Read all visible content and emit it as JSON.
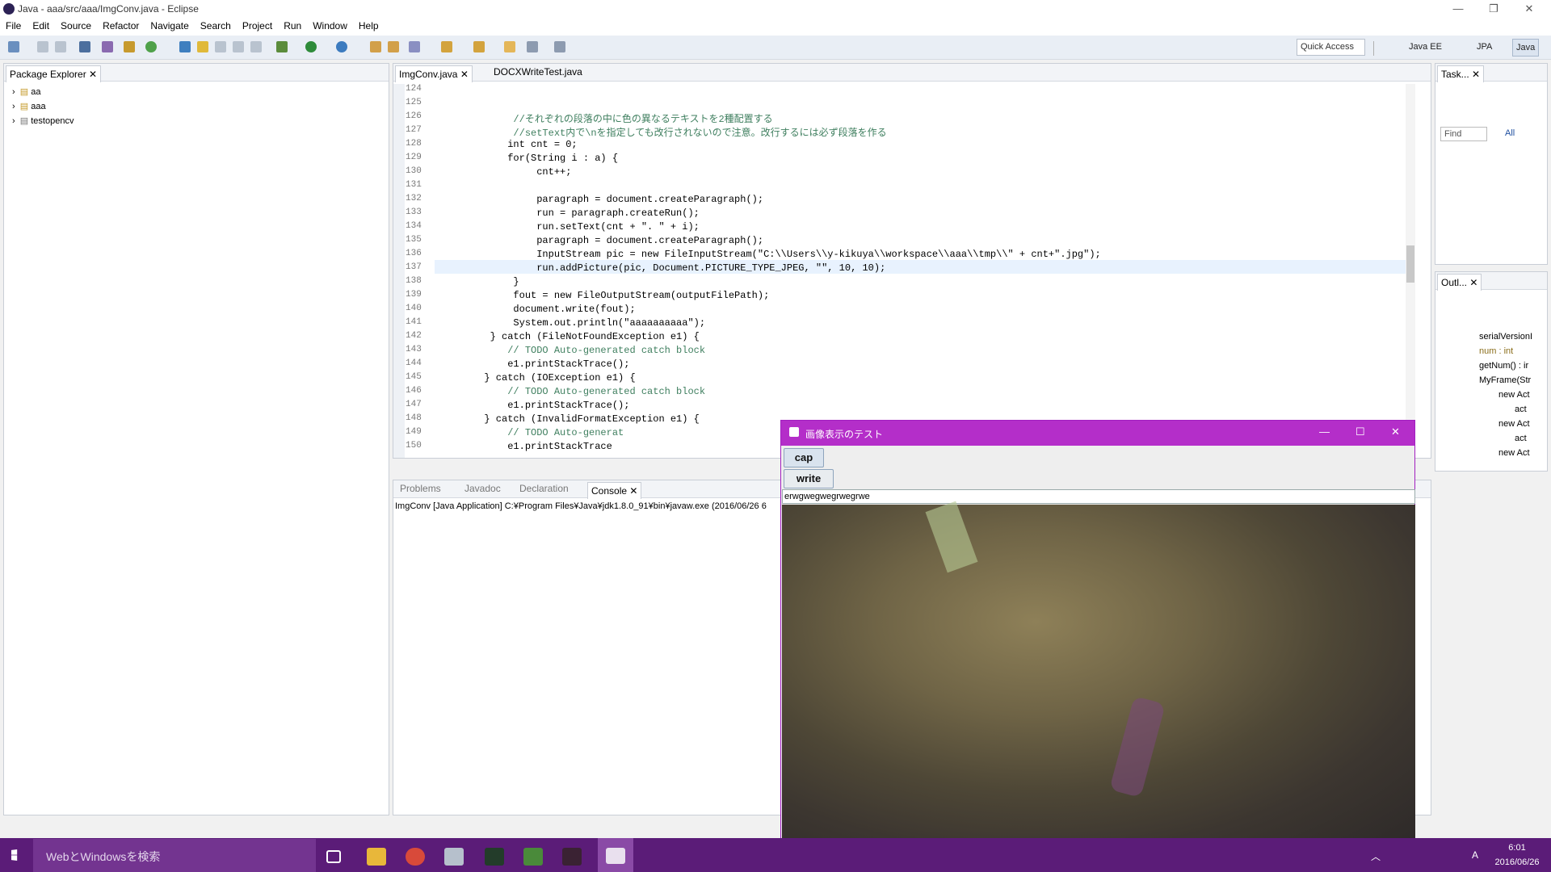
{
  "window": {
    "title": "Java - aaa/src/aaa/ImgConv.java - Eclipse",
    "min": "—",
    "max": "❐",
    "close": "✕"
  },
  "menu": [
    "File",
    "Edit",
    "Source",
    "Refactor",
    "Navigate",
    "Search",
    "Project",
    "Run",
    "Window",
    "Help"
  ],
  "toolbar": {
    "quick_access": "Quick Access"
  },
  "perspectives": [
    "Java EE",
    "JPA",
    "Java"
  ],
  "package_explorer": {
    "title": "Package Explorer",
    "items": [
      "aa",
      "aaa",
      "testopencv"
    ]
  },
  "editor": {
    "tabs": [
      "ImgConv.java",
      "DOCXWriteTest.java"
    ],
    "lines": [
      {
        "n": "124",
        "t": ""
      },
      {
        "n": "125",
        "t": ""
      },
      {
        "n": "126",
        "t": "            //それぞれの段落の中に色の異なるテキストを2種配置する",
        "c": "cm"
      },
      {
        "n": "127",
        "t": "            //setText内で\\nを指定しても改行されないので注意。改行するには必ず段落を作る",
        "c": "cm"
      },
      {
        "n": "128",
        "t": "           int cnt = 0;"
      },
      {
        "n": "129",
        "t": "           for(String i : a) {"
      },
      {
        "n": "130",
        "t": "                cnt++;"
      },
      {
        "n": "131",
        "t": ""
      },
      {
        "n": "132",
        "t": "                paragraph = document.createParagraph();"
      },
      {
        "n": "133",
        "t": "                run = paragraph.createRun();"
      },
      {
        "n": "134",
        "t": "                run.setText(cnt + \". \" + i);"
      },
      {
        "n": "135",
        "t": "                paragraph = document.createParagraph();"
      },
      {
        "n": "136",
        "t": "                InputStream pic = new FileInputStream(\"C:\\\\Users\\\\y-kikuya\\\\workspace\\\\aaa\\\\tmp\\\\\" + cnt+\".jpg\");"
      },
      {
        "n": "137",
        "t": "                run.addPicture(pic, Document.PICTURE_TYPE_JPEG, \"\", 10, 10);"
      },
      {
        "n": "138",
        "t": "            }"
      },
      {
        "n": "139",
        "t": "            fout = new FileOutputStream(outputFilePath);"
      },
      {
        "n": "140",
        "t": "            document.write(fout);"
      },
      {
        "n": "141",
        "t": "            System.out.println(\"aaaaaaaaaa\");"
      },
      {
        "n": "142",
        "t": "        } catch (FileNotFoundException e1) {"
      },
      {
        "n": "143",
        "t": "           // TODO Auto-generated catch block",
        "c": "cm"
      },
      {
        "n": "144",
        "t": "           e1.printStackTrace();"
      },
      {
        "n": "145",
        "t": "       } catch (IOException e1) {"
      },
      {
        "n": "146",
        "t": "           // TODO Auto-generated catch block",
        "c": "cm"
      },
      {
        "n": "147",
        "t": "           e1.printStackTrace();"
      },
      {
        "n": "148",
        "t": "       } catch (InvalidFormatException e1) {"
      },
      {
        "n": "149",
        "t": "           // TODO Auto-generat",
        "c": "cm"
      },
      {
        "n": "150",
        "t": "           e1.printStackTrace"
      }
    ]
  },
  "bottom": {
    "tabs": [
      "Problems",
      "Javadoc",
      "Declaration",
      "Console"
    ],
    "console_line": "ImgConv [Java Application] C:¥Program Files¥Java¥jdk1.8.0_91¥bin¥javaw.exe (2016/06/26 6"
  },
  "tasks": {
    "title": "Task...",
    "find_placeholder": "Find",
    "all": "All"
  },
  "outline": {
    "title": "Outl...",
    "items": [
      "serialVersionI",
      "num : int",
      "getNum() : ir",
      "MyFrame(Str",
      "new Act",
      "act",
      "new Act",
      "act",
      "new Act"
    ]
  },
  "jframe": {
    "title": "画像表示のテスト",
    "cap": "cap",
    "write": "write",
    "text": "erwgwegwegrwegrwe"
  },
  "taskbar": {
    "search": "WebとWindowsを検索",
    "time": "6:01",
    "date": "2016/06/26",
    "ime": "A"
  }
}
